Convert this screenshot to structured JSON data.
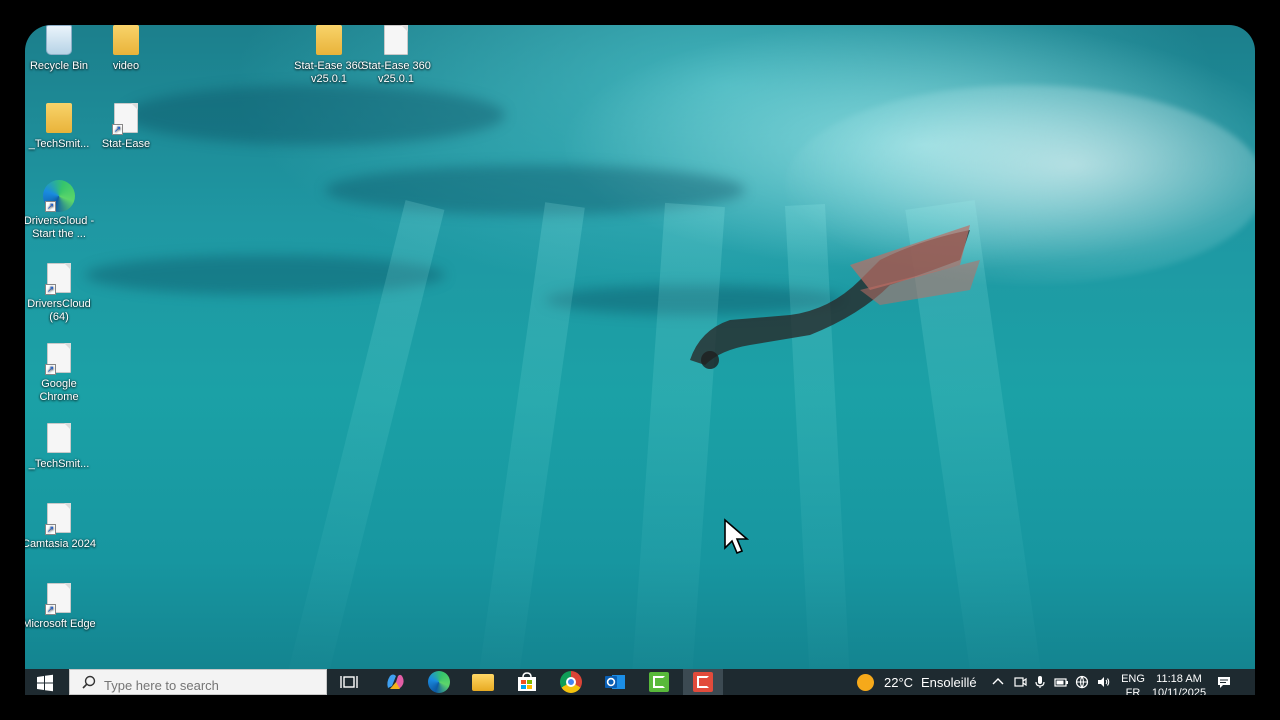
{
  "desktop": {
    "icons": [
      {
        "label": "Recycle Bin",
        "icon": "recycle-bin-icon"
      },
      {
        "label": "video",
        "icon": "folder-icon"
      },
      {
        "label": "Stat-Ease 360 v25.0.1",
        "icon": "folder-icon"
      },
      {
        "label": "Stat-Ease 360 v25.0.1",
        "icon": "file-icon"
      },
      {
        "label": "_TechSmit...",
        "icon": "folder-icon"
      },
      {
        "label": "Stat-Ease",
        "icon": "shortcut-file-icon"
      },
      {
        "label": "DriversCloud - Start the ...",
        "icon": "edge-shortcut-icon"
      },
      {
        "label": "DriversCloud (64)",
        "icon": "shortcut-file-icon"
      },
      {
        "label": "Google Chrome",
        "icon": "shortcut-file-icon"
      },
      {
        "label": "_TechSmit...",
        "icon": "file-icon"
      },
      {
        "label": "Camtasia 2024",
        "icon": "shortcut-file-icon"
      },
      {
        "label": "Microsoft Edge",
        "icon": "shortcut-file-icon"
      }
    ]
  },
  "taskbar": {
    "search_placeholder": "Type here to search",
    "apps": [
      "task-view",
      "copilot",
      "edge",
      "file-explorer",
      "microsoft-store",
      "chrome",
      "outlook",
      "camtasia-green",
      "camtasia-red"
    ],
    "active_app": "camtasia-red",
    "weather_temp": "22°C",
    "weather_desc": "Ensoleillé",
    "language": "ENG",
    "language_sub": "FR",
    "time": "11:18 AM",
    "date": "10/11/2025"
  },
  "colors": {
    "taskbar_bg": "#1e2a30",
    "water": "#1ba1a6"
  }
}
